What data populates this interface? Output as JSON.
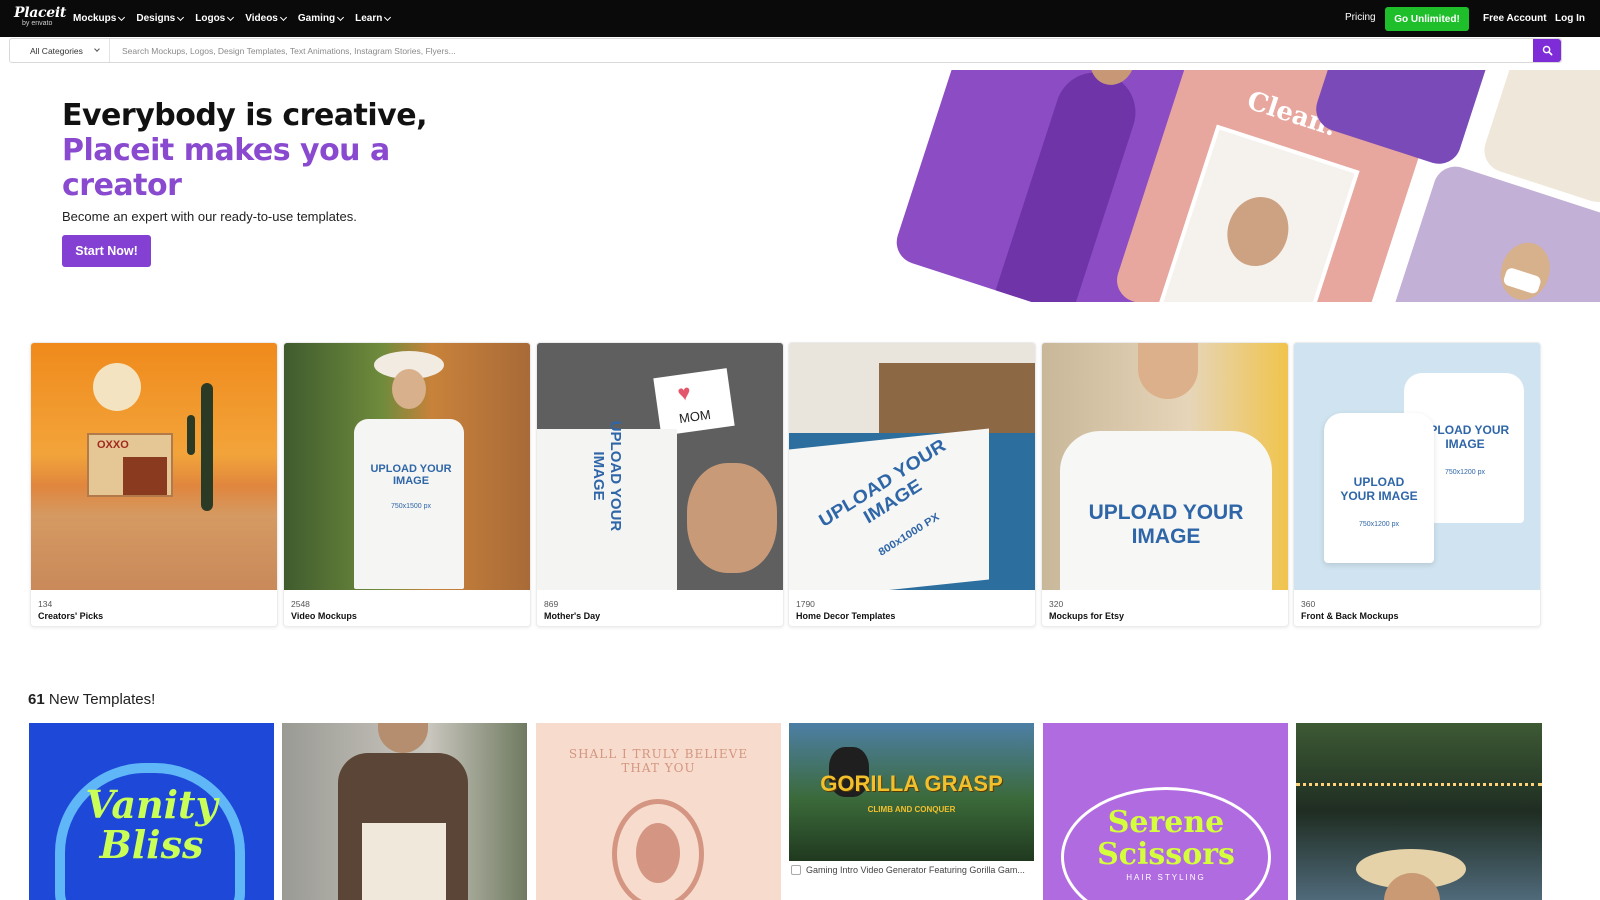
{
  "brand": {
    "logo": "Placeit",
    "logo_sub": "by envato"
  },
  "nav": {
    "items": [
      "Mockups",
      "Designs",
      "Logos",
      "Videos",
      "Gaming",
      "Learn"
    ],
    "pricing": "Pricing",
    "go_unlimited": "Go Unlimited!",
    "free_account": "Free Account",
    "login": "Log In"
  },
  "search": {
    "category": "All Categories",
    "placeholder": "Search Mockups, Logos, Design Templates, Text Animations, Instagram Stories, Flyers..."
  },
  "hero": {
    "title_line1": "Everybody is creative,",
    "title_line2": "Placeit makes you a creator",
    "subtitle": "Become an expert with our ready-to-use templates.",
    "cta": "Start Now!",
    "collage_card_text": "Clean."
  },
  "categories": [
    {
      "count": "134",
      "title": "Creators' Picks"
    },
    {
      "count": "2548",
      "title": "Video Mockups"
    },
    {
      "count": "869",
      "title": "Mother's Day"
    },
    {
      "count": "1790",
      "title": "Home Decor Templates"
    },
    {
      "count": "320",
      "title": "Mockups for Etsy"
    },
    {
      "count": "360",
      "title": "Front & Back Mockups"
    }
  ],
  "image_text": {
    "store_sign": "OXXO",
    "upload": "UPLOAD YOUR IMAGE",
    "size_750": "750x1500 px",
    "size_800": "800x1000 PX",
    "size_750b": "750x1200 px",
    "mom_card": "MOM"
  },
  "new_templates": {
    "count": "61",
    "label": "New Templates!",
    "items": [
      {
        "art_text": "Vanity Bliss"
      },
      {
        "art_text": ""
      },
      {
        "art_text": "SHALL I TRULY BELIEVE THAT YOU"
      },
      {
        "art_text": "GORILLA GRASP",
        "art_sub": "CLIMB AND CONQUER",
        "caption": "Gaming Intro Video Generator Featuring Gorilla Gam..."
      },
      {
        "art_text": "Serene Scissors",
        "art_sub": "HAIR STYLING"
      },
      {
        "art_text": ""
      }
    ]
  },
  "colors": {
    "accent": "#8440d3",
    "cta_green": "#1fbf2c",
    "topbar": "#0a0a0a"
  }
}
